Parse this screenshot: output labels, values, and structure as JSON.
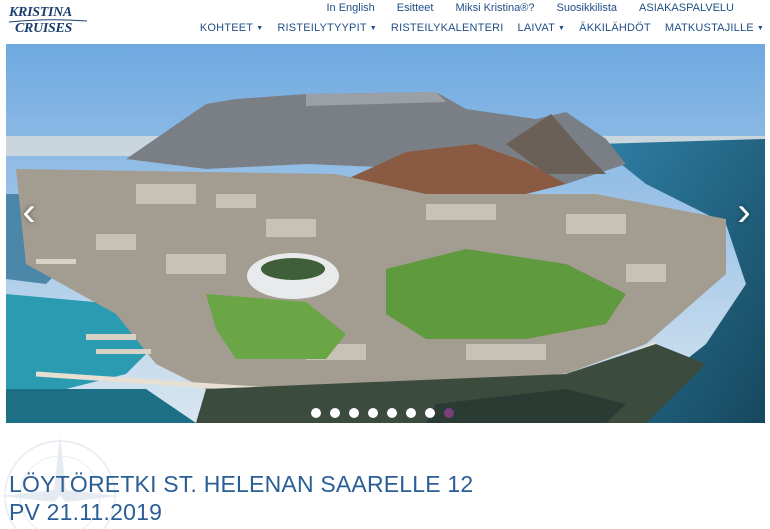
{
  "logo": {
    "line1": "KRISTINA",
    "line2": "CRUISES"
  },
  "top_links": [
    {
      "label": "In English"
    },
    {
      "label": "Esitteet"
    },
    {
      "label": "Miksi Kristina®?"
    },
    {
      "label": "Suosikkilista"
    },
    {
      "label": "ASIAKASPALVELU"
    }
  ],
  "main_nav": [
    {
      "label": "KOHTEET",
      "dropdown": true
    },
    {
      "label": "RISTEILYTYYPIT",
      "dropdown": true
    },
    {
      "label": "RISTEILYKALENTERI",
      "dropdown": false
    },
    {
      "label": "LAIVAT",
      "dropdown": true
    },
    {
      "label": "ÄKKILÄHDÖT",
      "dropdown": false
    },
    {
      "label": "MATKUSTAJILLE",
      "dropdown": true
    }
  ],
  "carousel": {
    "prev_glyph": "‹",
    "next_glyph": "›",
    "slide_count": 8,
    "active_index": 7
  },
  "page_title": {
    "line1": "LÖYTÖRETKI ST. HELENAN SAARELLE 12",
    "line2": "PV 21.11.2019"
  },
  "colors": {
    "nav": "#1f4f86",
    "title": "#2b5e96",
    "active_dot": "#7a3f7a",
    "logo": "#1a3f6e"
  }
}
